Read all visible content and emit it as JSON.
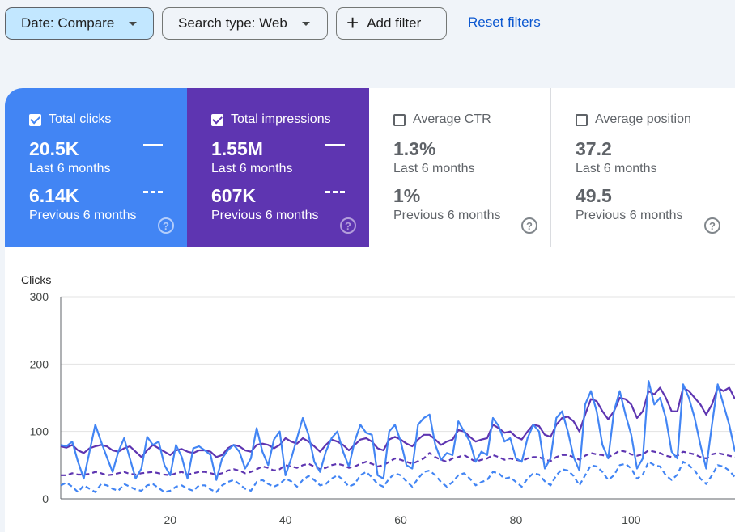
{
  "filters": {
    "date_label": "Date: Compare",
    "search_type_label": "Search type: Web",
    "add_filter_label": "Add filter",
    "reset_label": "Reset filters"
  },
  "metrics": [
    {
      "label": "Total clicks",
      "checked": true,
      "value_current": "20.5K",
      "period_current": "Last 6 months",
      "value_previous": "6.14K",
      "period_previous": "Previous 6 months"
    },
    {
      "label": "Total impressions",
      "checked": true,
      "value_current": "1.55M",
      "period_current": "Last 6 months",
      "value_previous": "607K",
      "period_previous": "Previous 6 months"
    },
    {
      "label": "Average CTR",
      "checked": false,
      "value_current": "1.3%",
      "period_current": "Last 6 months",
      "value_previous": "1%",
      "period_previous": "Previous 6 months"
    },
    {
      "label": "Average position",
      "checked": false,
      "value_current": "37.2",
      "period_current": "Last 6 months",
      "value_previous": "49.5",
      "period_previous": "Previous 6 months"
    }
  ],
  "help_glyph": "?",
  "colors": {
    "clicks": "#4285f4",
    "impressions": "#5e35b1",
    "clicks_prev": "#4285f4",
    "impressions_prev": "#5e35b1"
  },
  "chart_data": {
    "type": "line",
    "ylabel": "Clicks",
    "ylim": [
      0,
      300
    ],
    "yticks": [
      0,
      100,
      200,
      300
    ],
    "xlim": [
      1,
      118
    ],
    "xticks": [
      20,
      40,
      60,
      80,
      100
    ],
    "grid": true,
    "series": [
      {
        "values": [
          80,
          78,
          85,
          55,
          30,
          70,
          110,
          85,
          62,
          40,
          70,
          90,
          60,
          30,
          45,
          92,
          80,
          85,
          50,
          35,
          80,
          62,
          30,
          75,
          78,
          72,
          65,
          28,
          60,
          72,
          80,
          70,
          45,
          60,
          105,
          70,
          50,
          88,
          100,
          35,
          60,
          90,
          120,
          95,
          55,
          40,
          70,
          90,
          100,
          70,
          48,
          85,
          110,
          98,
          95,
          35,
          30,
          100,
          110,
          85,
          50,
          45,
          110,
          120,
          125,
          80,
          58,
          68,
          65,
          115,
          100,
          85,
          55,
          70,
          65,
          120,
          108,
          85,
          90,
          60,
          55,
          90,
          110,
          100,
          45,
          60,
          120,
          130,
          100,
          62,
          42,
          140,
          160,
          130,
          80,
          60,
          130,
          160,
          125,
          95,
          45,
          60,
          175,
          140,
          150,
          120,
          70,
          60,
          170,
          150,
          120,
          80,
          45,
          110,
          170,
          140,
          110,
          70
        ]
      },
      {
        "values": [
          78,
          76,
          80,
          72,
          68,
          75,
          78,
          80,
          78,
          72,
          70,
          75,
          78,
          70,
          62,
          72,
          80,
          75,
          70,
          65,
          72,
          74,
          70,
          68,
          72,
          72,
          70,
          62,
          65,
          75,
          80,
          78,
          72,
          70,
          80,
          82,
          80,
          75,
          80,
          90,
          85,
          82,
          90,
          85,
          78,
          70,
          80,
          88,
          85,
          80,
          72,
          80,
          88,
          90,
          85,
          75,
          72,
          88,
          92,
          88,
          82,
          78,
          88,
          95,
          95,
          88,
          80,
          85,
          88,
          102,
          100,
          92,
          85,
          88,
          90,
          110,
          105,
          98,
          100,
          92,
          88,
          100,
          110,
          108,
          95,
          92,
          110,
          120,
          122,
          115,
          100,
          125,
          148,
          145,
          130,
          118,
          130,
          150,
          148,
          140,
          120,
          130,
          160,
          155,
          165,
          150,
          130,
          130,
          165,
          160,
          150,
          140,
          125,
          140,
          165,
          160,
          165,
          148
        ]
      },
      {
        "values": [
          35,
          35,
          38,
          36,
          36,
          37,
          40,
          38,
          35,
          36,
          38,
          40,
          37,
          36,
          38,
          39,
          40,
          38,
          36,
          35,
          38,
          40,
          36,
          38,
          40,
          40,
          38,
          36,
          38,
          42,
          44,
          42,
          38,
          40,
          44,
          48,
          46,
          42,
          44,
          50,
          48,
          46,
          50,
          52,
          48,
          44,
          46,
          50,
          52,
          50,
          46,
          48,
          52,
          55,
          52,
          48,
          50,
          55,
          60,
          58,
          55,
          52,
          56,
          60,
          68,
          62,
          58,
          55,
          60,
          62,
          65,
          60,
          55,
          58,
          60,
          65,
          62,
          58,
          60,
          58,
          56,
          60,
          62,
          62,
          58,
          56,
          62,
          65,
          65,
          62,
          58,
          64,
          68,
          66,
          65,
          62,
          66,
          72,
          70,
          66,
          64,
          66,
          72,
          70,
          68,
          64,
          62,
          64,
          70,
          68,
          66,
          62,
          60,
          66,
          68,
          66,
          64,
          62
        ]
      },
      {
        "values": [
          20,
          24,
          18,
          10,
          20,
          15,
          10,
          22,
          20,
          15,
          12,
          22,
          18,
          14,
          12,
          20,
          22,
          16,
          10,
          12,
          18,
          20,
          15,
          12,
          20,
          20,
          14,
          10,
          20,
          25,
          28,
          22,
          15,
          12,
          25,
          28,
          22,
          18,
          22,
          30,
          26,
          18,
          28,
          34,
          28,
          20,
          22,
          30,
          35,
          28,
          18,
          22,
          35,
          40,
          32,
          22,
          18,
          30,
          38,
          35,
          26,
          18,
          30,
          40,
          42,
          35,
          25,
          18,
          25,
          35,
          38,
          30,
          20,
          25,
          28,
          40,
          38,
          30,
          32,
          25,
          18,
          30,
          38,
          36,
          26,
          20,
          35,
          44,
          42,
          34,
          20,
          35,
          50,
          48,
          40,
          28,
          35,
          50,
          52,
          45,
          30,
          36,
          55,
          50,
          48,
          35,
          28,
          36,
          55,
          50,
          42,
          30,
          22,
          35,
          50,
          48,
          42,
          32
        ]
      }
    ]
  }
}
